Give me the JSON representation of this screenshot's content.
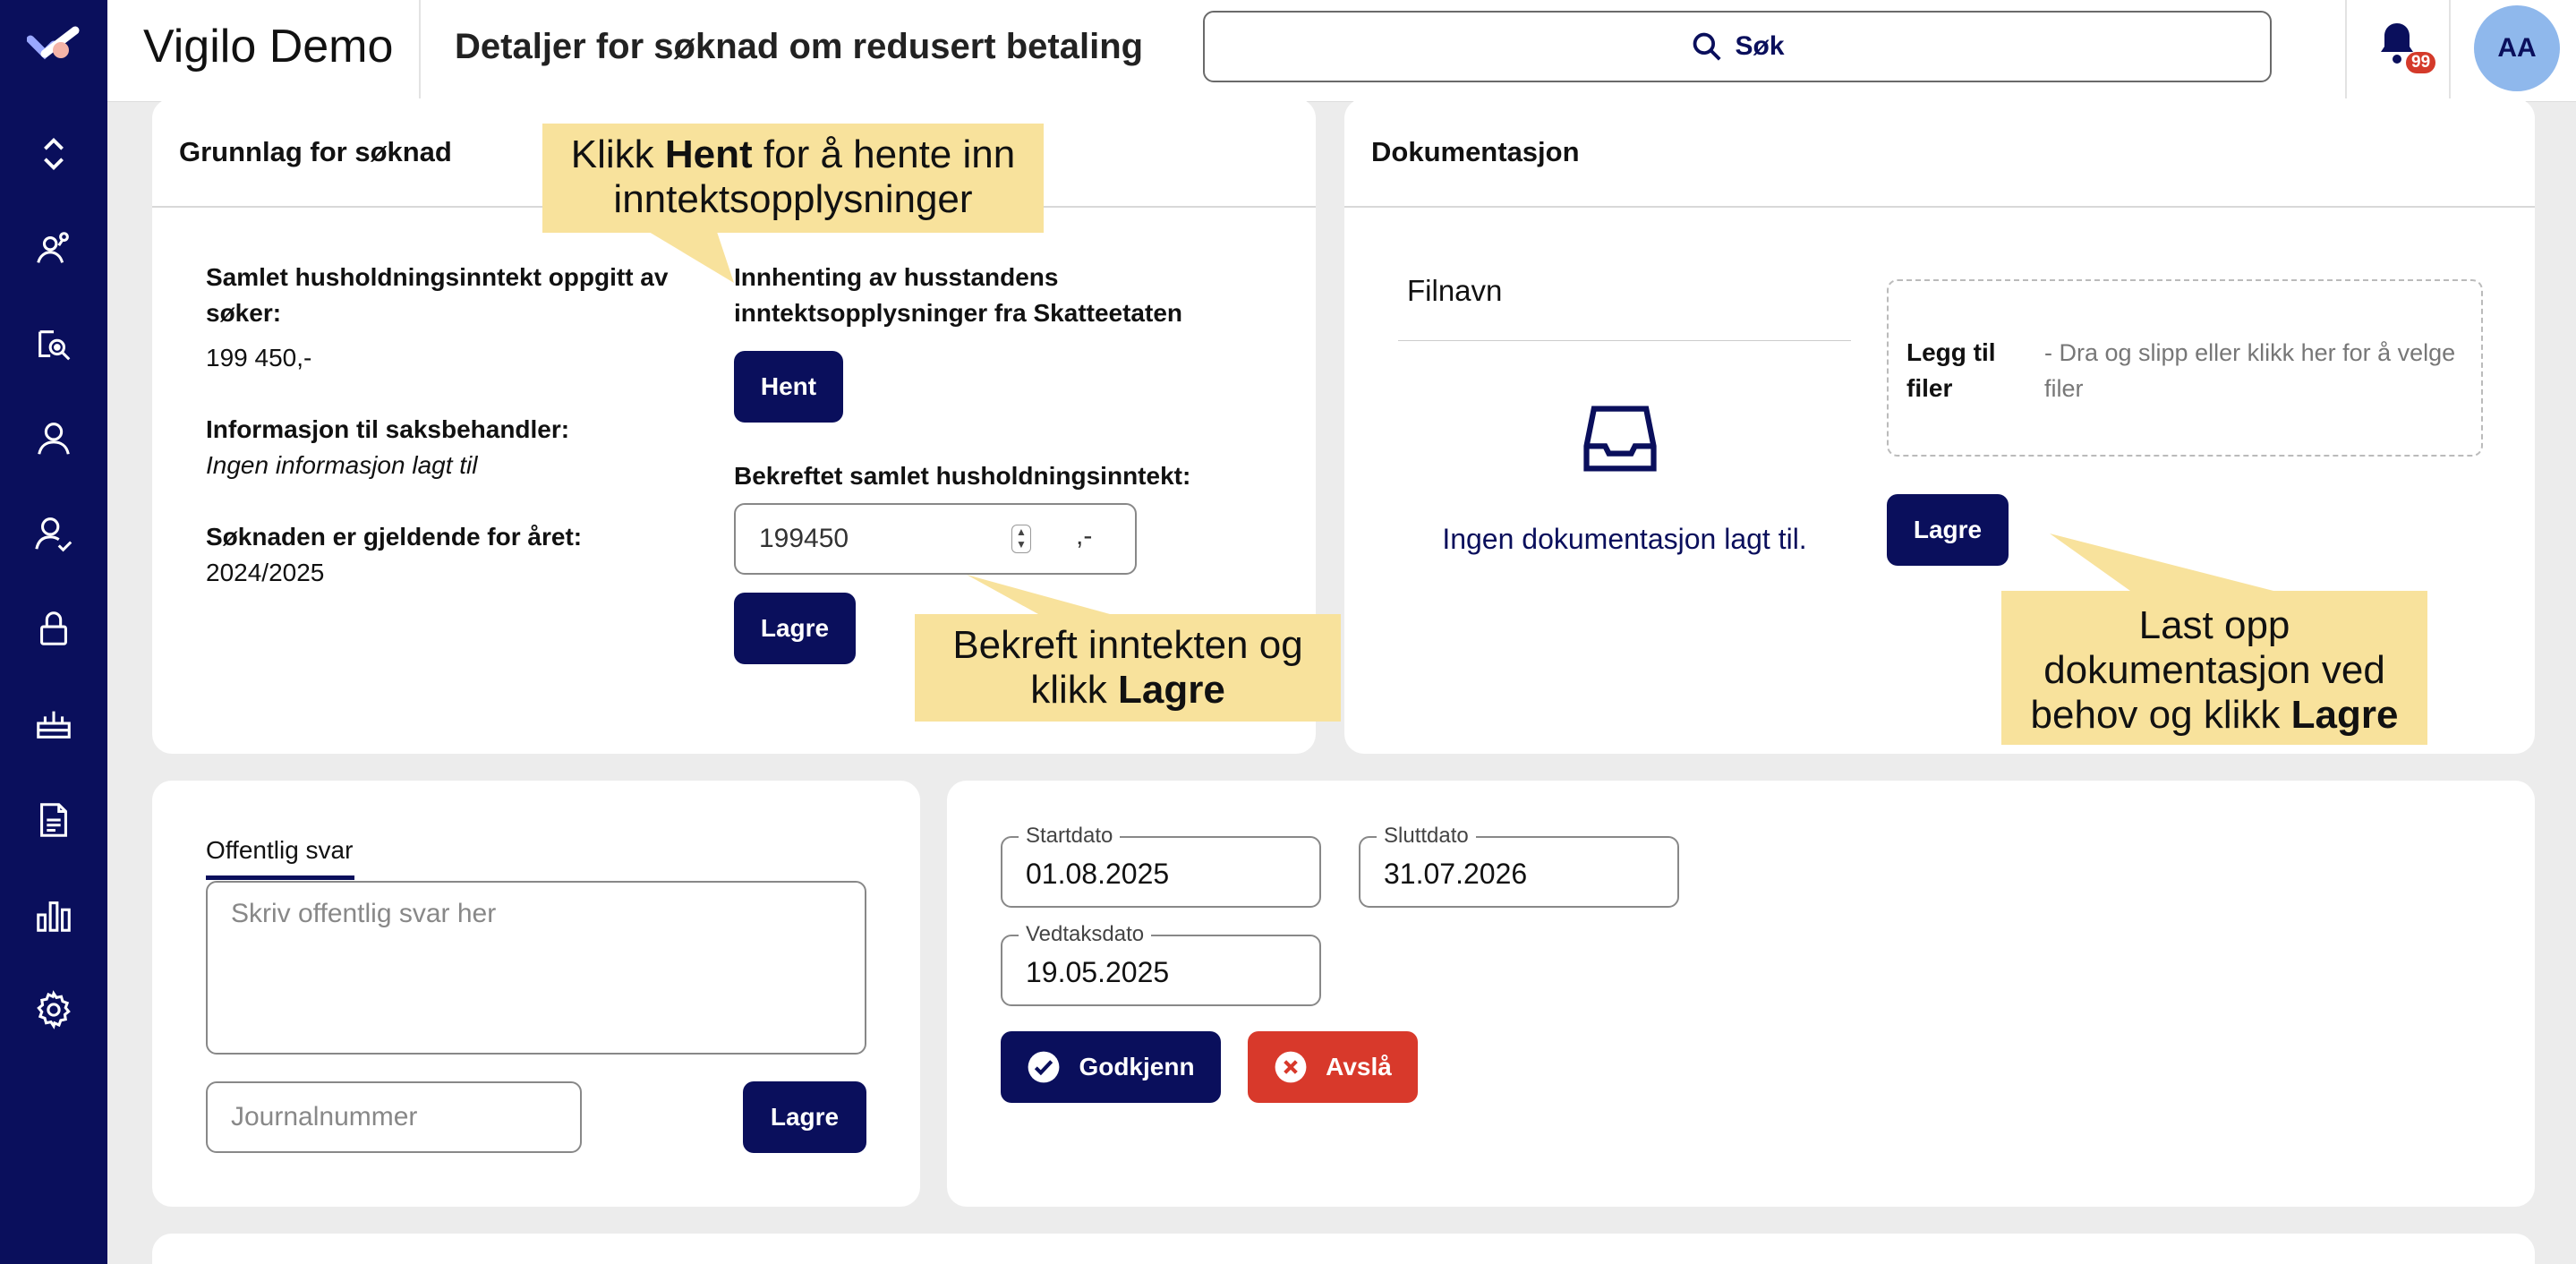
{
  "header": {
    "app_title": "Vigilo Demo",
    "page_title": "Detaljer for søknad om redusert betaling",
    "search_label": "Søk",
    "notification_count": "99",
    "avatar_initials": "AA"
  },
  "sidebar": {
    "icons": [
      "logo-icon",
      "expand-collapse-icon",
      "users-network-icon",
      "network-search-icon",
      "person-icon",
      "person-check-icon",
      "lock-icon",
      "inbox-tray-icon",
      "document-icon",
      "bar-chart-icon",
      "gear-icon"
    ]
  },
  "grunnlag": {
    "title": "Grunnlag for søknad",
    "income_label": "Samlet husholdningsinntekt oppgitt av søker:",
    "income_value": "199 450,-",
    "info_label": "Informasjon til saksbehandler:",
    "info_value": "Ingen informasjon lagt til",
    "year_label": "Søknaden er gjeldende for året:",
    "year_value": "2024/2025",
    "fetch_label": "Innhenting av husstandens inntektsopplysninger fra Skatteetaten",
    "fetch_button": "Hent",
    "confirmed_label": "Bekreftet samlet husholdningsinntekt:",
    "confirmed_value": "199450",
    "currency_suffix": ",-",
    "save_button": "Lagre"
  },
  "dokumentasjon": {
    "title": "Dokumentasjon",
    "column_filename": "Filnavn",
    "empty_text": "Ingen dokumentasjon lagt til.",
    "add_files_label": "Legg til filer",
    "add_files_hint": "- Dra og slipp eller klikk her for å velge filer",
    "save_button": "Lagre"
  },
  "svar": {
    "tab_label": "Offentlig svar",
    "textarea_placeholder": "Skriv offentlig svar her",
    "journal_placeholder": "Journalnummer",
    "save_button": "Lagre"
  },
  "vedtak": {
    "start_label": "Startdato",
    "start_value": "01.08.2025",
    "end_label": "Sluttdato",
    "end_value": "31.07.2026",
    "decision_label": "Vedtaksdato",
    "decision_value": "19.05.2025",
    "approve_button": "Godkjenn",
    "reject_button": "Avslå"
  },
  "callouts": {
    "hent_pre": "Klikk ",
    "hent_bold": "Hent",
    "hent_post": " for å hente inn inntektsopplysninger",
    "lagre_pre": "Bekreft inntekten og klikk ",
    "lagre_bold": "Lagre",
    "doc_pre": "Last opp dokumentasjon ved behov og klikk ",
    "doc_bold": "Lagre"
  },
  "colors": {
    "primary": "#0a0f5c",
    "danger": "#d8392b",
    "callout": "#f8e29c",
    "avatar": "#8fb8ec"
  }
}
